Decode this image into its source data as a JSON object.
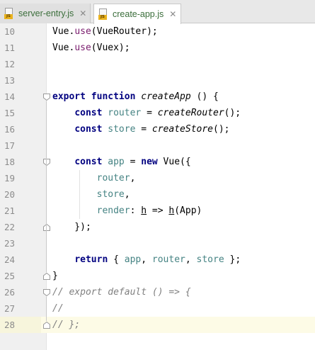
{
  "tabs": [
    {
      "name": "server-entry.js",
      "icon": "js-file-icon",
      "badge": "JS",
      "active": false
    },
    {
      "name": "create-app.js",
      "icon": "js-file-icon",
      "badge": "JS",
      "active": true
    }
  ],
  "close_glyph": "✕",
  "editor": {
    "current_line": 28,
    "lines": [
      {
        "num": "10",
        "tokens": [
          [
            "fn",
            "Vue."
          ],
          [
            "mth",
            "use"
          ],
          [
            "fn",
            "(VueRouter);"
          ]
        ]
      },
      {
        "num": "11",
        "tokens": [
          [
            "fn",
            "Vue."
          ],
          [
            "mth",
            "use"
          ],
          [
            "fn",
            "(Vuex);"
          ]
        ]
      },
      {
        "num": "12",
        "tokens": []
      },
      {
        "num": "13",
        "tokens": []
      },
      {
        "num": "14",
        "tokens": [
          [
            "kw",
            "export"
          ],
          [
            "fn",
            " "
          ],
          [
            "kw",
            "function"
          ],
          [
            "fn",
            " "
          ],
          [
            "ifn",
            "createApp"
          ],
          [
            "fn",
            " () {"
          ]
        ]
      },
      {
        "num": "15",
        "tokens": [
          [
            "fn",
            "    "
          ],
          [
            "kw",
            "const"
          ],
          [
            "fn",
            " "
          ],
          [
            "var",
            "router"
          ],
          [
            "fn",
            " = "
          ],
          [
            "ifn",
            "createRouter"
          ],
          [
            "fn",
            "();"
          ]
        ]
      },
      {
        "num": "16",
        "tokens": [
          [
            "fn",
            "    "
          ],
          [
            "kw",
            "const"
          ],
          [
            "fn",
            " "
          ],
          [
            "var",
            "store"
          ],
          [
            "fn",
            " = "
          ],
          [
            "ifn",
            "createStore"
          ],
          [
            "fn",
            "();"
          ]
        ]
      },
      {
        "num": "17",
        "tokens": []
      },
      {
        "num": "18",
        "tokens": [
          [
            "fn",
            "    "
          ],
          [
            "kw",
            "const"
          ],
          [
            "fn",
            " "
          ],
          [
            "var",
            "app"
          ],
          [
            "fn",
            " = "
          ],
          [
            "kw",
            "new"
          ],
          [
            "fn",
            " Vue({"
          ]
        ]
      },
      {
        "num": "19",
        "tokens": [
          [
            "fn",
            "        "
          ],
          [
            "prop",
            "router"
          ],
          [
            "fn",
            ","
          ]
        ]
      },
      {
        "num": "20",
        "tokens": [
          [
            "fn",
            "        "
          ],
          [
            "prop",
            "store"
          ],
          [
            "fn",
            ","
          ]
        ]
      },
      {
        "num": "21",
        "tokens": [
          [
            "fn",
            "        "
          ],
          [
            "prop",
            "render"
          ],
          [
            "fn",
            ": "
          ],
          [
            "ul",
            "h"
          ],
          [
            "fn",
            " => "
          ],
          [
            "ul",
            "h"
          ],
          [
            "fn",
            "(App)"
          ]
        ]
      },
      {
        "num": "22",
        "tokens": [
          [
            "fn",
            "    });"
          ]
        ]
      },
      {
        "num": "23",
        "tokens": []
      },
      {
        "num": "24",
        "tokens": [
          [
            "fn",
            "    "
          ],
          [
            "kw",
            "return"
          ],
          [
            "fn",
            " { "
          ],
          [
            "var",
            "app"
          ],
          [
            "fn",
            ", "
          ],
          [
            "var",
            "router"
          ],
          [
            "fn",
            ", "
          ],
          [
            "var",
            "store"
          ],
          [
            "fn",
            " };"
          ]
        ]
      },
      {
        "num": "25",
        "tokens": [
          [
            "fn",
            "}"
          ]
        ]
      },
      {
        "num": "26",
        "tokens": [
          [
            "cmt",
            "// export default () => {"
          ]
        ]
      },
      {
        "num": "27",
        "tokens": [
          [
            "cmt",
            "//"
          ]
        ]
      },
      {
        "num": "28",
        "tokens": [
          [
            "cmt",
            "// };"
          ]
        ]
      }
    ]
  }
}
